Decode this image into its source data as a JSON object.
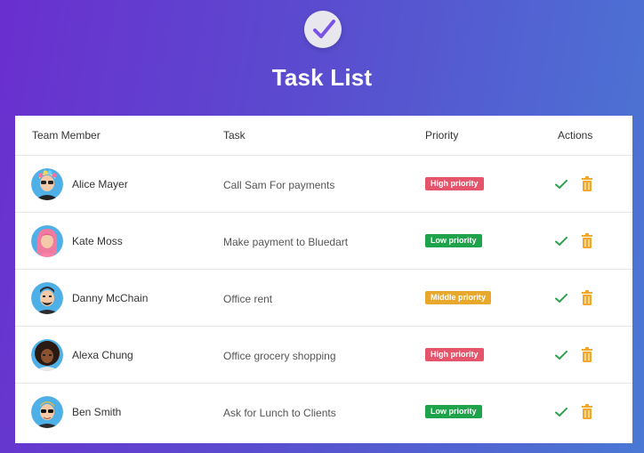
{
  "app": {
    "title": "Task List",
    "logo_icon": "check-circle-icon"
  },
  "table": {
    "headers": [
      "Team Member",
      "Task",
      "Priority",
      "Actions"
    ],
    "rows": [
      {
        "member": "Alice Mayer",
        "task": "Call Sam For payments",
        "priority": "High priority"
      },
      {
        "member": "Kate Moss",
        "task": "Make payment to Bluedart",
        "priority": "Low priority"
      },
      {
        "member": "Danny McChain",
        "task": "Office rent",
        "priority": "Middle priority"
      },
      {
        "member": "Alexa Chung",
        "task": "Office grocery shopping",
        "priority": "High priority"
      },
      {
        "member": "Ben Smith",
        "task": "Ask for Lunch to Clients",
        "priority": "Low priority"
      }
    ]
  },
  "colors": {
    "high": "#e5546b",
    "low": "#1fa34a",
    "middle": "#e8a82b",
    "check": "#2ea44f",
    "trash": "#f0a92a"
  }
}
